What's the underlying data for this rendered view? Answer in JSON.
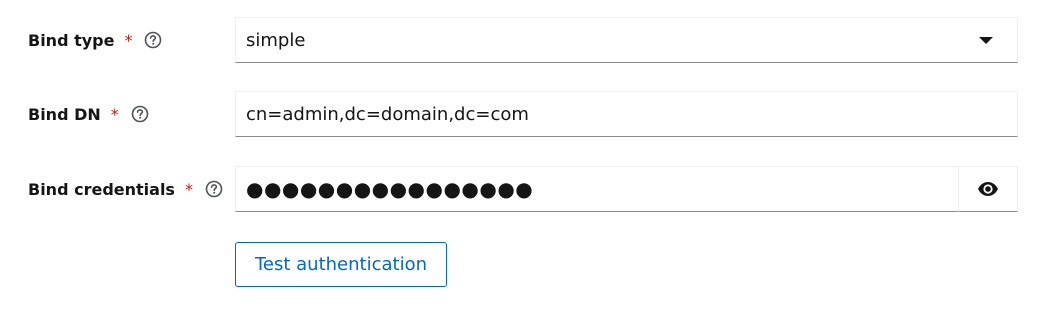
{
  "bind_type": {
    "label": "Bind type",
    "required_marker": "*",
    "help_icon": "question-circle-icon",
    "value": "simple",
    "caret_icon": "caret-down-icon"
  },
  "bind_dn": {
    "label": "Bind DN",
    "required_marker": "*",
    "help_icon": "question-circle-icon",
    "value": "cn=admin,dc=domain,dc=com"
  },
  "bind_credentials": {
    "label": "Bind credentials",
    "required_marker": "*",
    "help_icon": "question-circle-icon",
    "masked_value": "●●●●●●●●●●●●●●●●",
    "toggle_icon": "eye-icon"
  },
  "actions": {
    "test_label": "Test authentication"
  },
  "colors": {
    "required": "#c9190b",
    "link_blue": "#0066cc",
    "text": "#151515",
    "border_bottom": "#8a8d90"
  }
}
